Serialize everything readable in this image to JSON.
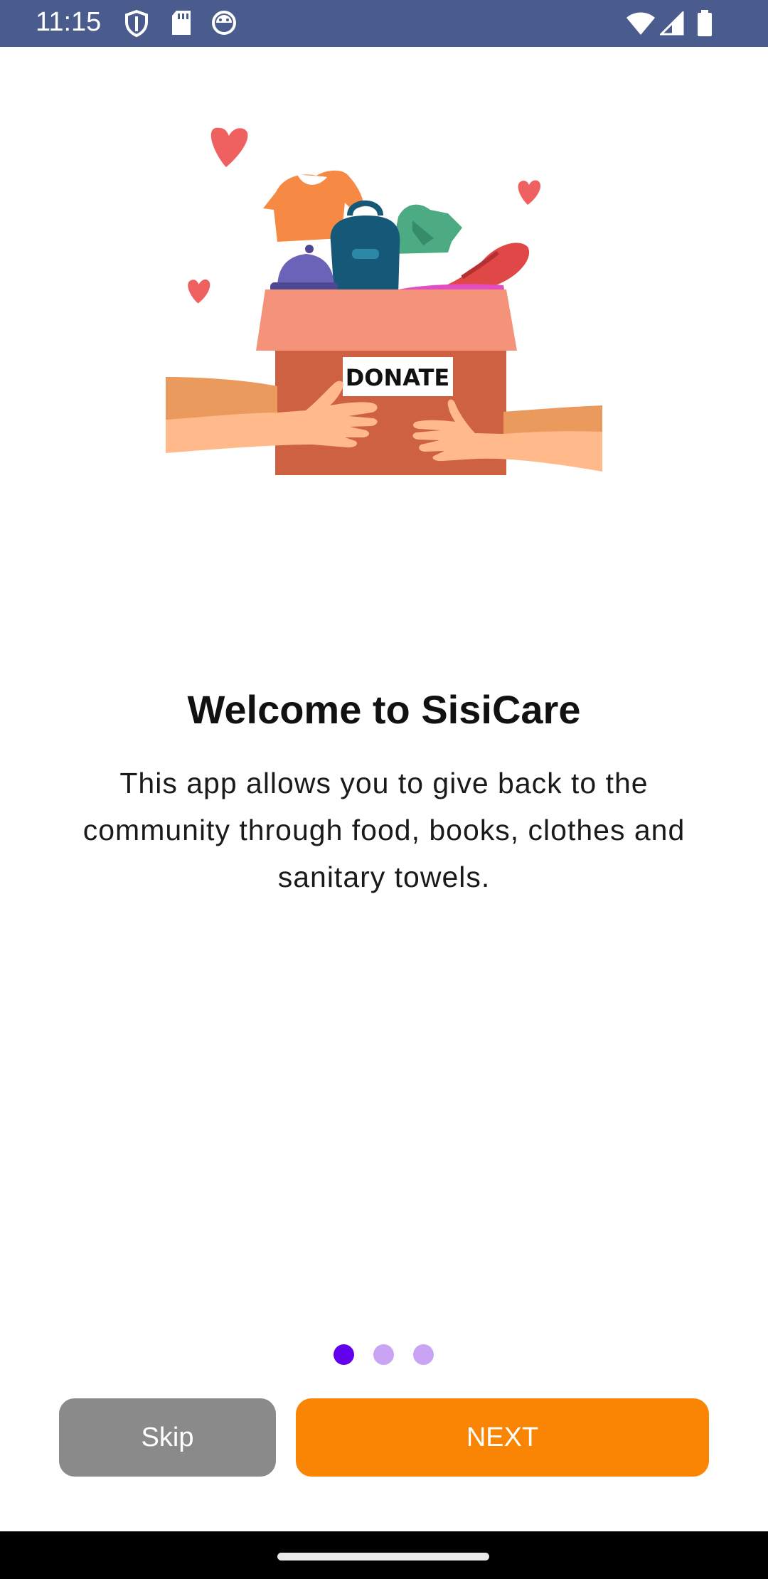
{
  "status_bar": {
    "time": "11:15",
    "icons": [
      "shield-icon",
      "sd-card-icon",
      "android-face-icon",
      "wifi-icon",
      "cellular-signal-icon",
      "battery-icon"
    ]
  },
  "illustration": {
    "sign_text": "DONATE"
  },
  "onboarding": {
    "title": "Welcome to SisiCare",
    "description": "This app allows you to give back to the community through food, books, clothes and sanitary towels.",
    "page_count": 3,
    "active_page": 1
  },
  "buttons": {
    "skip_label": "Skip",
    "next_label": "NEXT"
  },
  "colors": {
    "status_bar": "#4a5b8e",
    "dot_active": "#6200ee",
    "dot_inactive": "#c9a4f4",
    "skip_button": "#8a8a8a",
    "next_button": "#fa8504"
  }
}
